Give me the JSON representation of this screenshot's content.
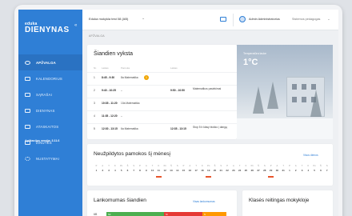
{
  "sidebar": {
    "logo_top": "eduka",
    "logo_main": "DIENYNAS",
    "collapse_glyph": "«",
    "items": [
      {
        "label": "APŽVALGA",
        "icon": "home-icon",
        "active": true
      },
      {
        "label": "KALENDORIUS",
        "icon": "calendar-icon"
      },
      {
        "label": "SĄRAŠAI",
        "icon": "list-icon"
      },
      {
        "label": "DIENYNAS",
        "icon": "monitor-icon"
      },
      {
        "label": "ATASKAITOS",
        "icon": "report-icon"
      },
      {
        "label": "ŽINUTĖS",
        "icon": "mail-icon"
      },
      {
        "label": "NUSTATYMAI",
        "icon": "gear-icon"
      }
    ],
    "version": "Aplikacijos versija: 3.11.6"
  },
  "topbar": {
    "school": "Eduka mokykla test 08 (AB)",
    "school_caret": "⌄",
    "user": "Admin Administratorius",
    "role": "Sistemos pedagogas",
    "role_caret": "⌄"
  },
  "breadcrumb": "APŽVALGA",
  "schedule": {
    "title": "Šiandien vyksta",
    "headers": [
      "Nr.",
      "Laikas",
      "Pamoka",
      "Laikas"
    ],
    "rows": [
      {
        "num": "1",
        "time": "8:45 - 9:30",
        "subject": "8a Matematika",
        "badge": "1",
        "time2": "",
        "subject2": ""
      },
      {
        "num": "2",
        "time": "9:40 - 10:25",
        "subject": "–",
        "badge": "",
        "time2": "9:50 - 10:50",
        "subject2": "Matematikos pasiekimai"
      },
      {
        "num": "3",
        "time": "10:35 - 11:20",
        "subject": "10a Matematika",
        "badge": "",
        "time2": "",
        "subject2": ""
      },
      {
        "num": "4",
        "time": "11:35 - 12:20",
        "subject": "–",
        "badge": "",
        "time2": "",
        "subject2": ""
      },
      {
        "num": "5",
        "time": "12:30 - 13:15",
        "subject": "6a Matematika",
        "badge": "",
        "time2": "12:35 - 13:15",
        "subject2": "Stop 5 b klasy biuško į dangą"
      }
    ]
  },
  "weather": {
    "label": "Temperatūra lauke",
    "temperature": "1°C"
  },
  "missing": {
    "title": "Neužpildytos pamokos šį mėnesį",
    "link": "Visos dienos",
    "days": [
      {
        "w": "P",
        "n": "1"
      },
      {
        "w": "A",
        "n": "2"
      },
      {
        "w": "T",
        "n": "3"
      },
      {
        "w": "K",
        "n": "4"
      },
      {
        "w": "Pn",
        "n": "5"
      },
      {
        "w": "Š",
        "n": "6"
      },
      {
        "w": "S",
        "n": "7"
      },
      {
        "w": "P",
        "n": "8"
      },
      {
        "w": "A",
        "n": "9"
      },
      {
        "w": "T",
        "n": "10"
      },
      {
        "w": "K",
        "n": "11",
        "mark": true
      },
      {
        "w": "Pn",
        "n": "12"
      },
      {
        "w": "Š",
        "n": "13"
      },
      {
        "w": "S",
        "n": "14"
      },
      {
        "w": "P",
        "n": "15"
      },
      {
        "w": "A",
        "n": "16"
      },
      {
        "w": "T",
        "n": "17"
      },
      {
        "w": "K",
        "n": "18"
      },
      {
        "w": "Pn",
        "n": "19",
        "mark": true
      },
      {
        "w": "Š",
        "n": "20"
      },
      {
        "w": "S",
        "n": "21"
      },
      {
        "w": "P",
        "n": "22"
      },
      {
        "w": "A",
        "n": "23"
      },
      {
        "w": "T",
        "n": "24"
      },
      {
        "w": "K",
        "n": "25"
      },
      {
        "w": "Pn",
        "n": "26"
      },
      {
        "w": "Š",
        "n": "27"
      },
      {
        "w": "S",
        "n": "28"
      },
      {
        "w": "P",
        "n": "29",
        "mark": true
      },
      {
        "w": "A",
        "n": "30"
      },
      {
        "w": "T",
        "n": "31"
      },
      {
        "w": "P",
        "n": "1"
      },
      {
        "w": "A",
        "n": "2"
      },
      {
        "w": "T",
        "n": "3"
      },
      {
        "w": "K",
        "n": "4"
      },
      {
        "w": "Pn",
        "n": "5"
      },
      {
        "w": "Š",
        "n": "6"
      },
      {
        "w": "S",
        "n": "7"
      }
    ]
  },
  "attendance": {
    "title": "Lankomumas šiandien",
    "link": "Visas lankomumas",
    "class": "6B",
    "segments": [
      {
        "label": "Nd",
        "share": 0.48,
        "color": "#4caf50"
      },
      {
        "label": "Nl",
        "share": 0.32,
        "color": "#e53935"
      },
      {
        "label": "N",
        "share": 0.2,
        "color": "#ff9800"
      }
    ]
  },
  "ratings": {
    "title": "Klasės reitingas mokykloje"
  }
}
